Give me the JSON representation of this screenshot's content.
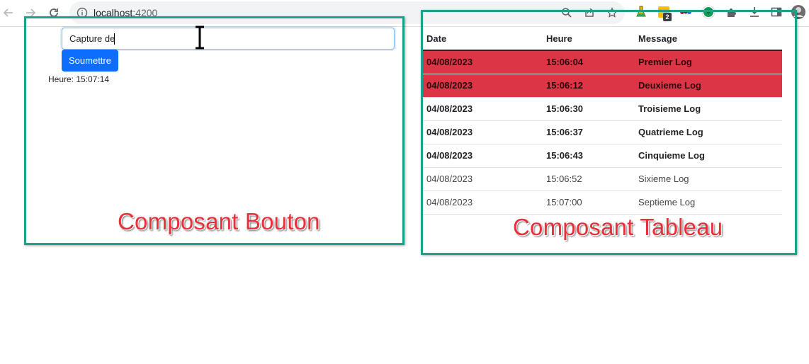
{
  "browser": {
    "url_host": "localhost",
    "url_port": ":4200",
    "extension_badge": "2"
  },
  "button_component": {
    "input_value": "Capture de",
    "submit_label": "Soumettre",
    "time_text": "Heure: 15:07:14",
    "caption": "Composant Bouton"
  },
  "table_component": {
    "headers": [
      "Date",
      "Heure",
      "Message"
    ],
    "rows": [
      {
        "date": "04/08/2023",
        "heure": "15:06:04",
        "message": "Premier Log",
        "style": "danger"
      },
      {
        "date": "04/08/2023",
        "heure": "15:06:12",
        "message": "Deuxieme Log",
        "style": "danger"
      },
      {
        "date": "04/08/2023",
        "heure": "15:06:30",
        "message": "Troisieme Log",
        "style": "bold"
      },
      {
        "date": "04/08/2023",
        "heure": "15:06:37",
        "message": "Quatrieme Log",
        "style": "bold"
      },
      {
        "date": "04/08/2023",
        "heure": "15:06:43",
        "message": "Cinquieme Log",
        "style": "bold"
      },
      {
        "date": "04/08/2023",
        "heure": "15:06:52",
        "message": "Sixieme Log",
        "style": "normal"
      },
      {
        "date": "04/08/2023",
        "heure": "15:07:00",
        "message": "Septieme Log",
        "style": "normal"
      }
    ],
    "caption": "Composant Tableau"
  },
  "colors": {
    "frame": "#1aa38a",
    "danger_row": "#dc3545",
    "primary_button": "#0d6efd",
    "caption": "#e8303b"
  },
  "icons": [
    "back-arrow-icon",
    "forward-arrow-icon",
    "reload-icon",
    "info-icon",
    "zoom-icon",
    "share-icon",
    "bookmark-star-icon",
    "flask-extension-icon",
    "yellow-extension-icon",
    "bird-extension-icon",
    "green-extension-icon",
    "puzzle-extensions-icon",
    "download-icon",
    "side-panel-icon",
    "profile-avatar-icon",
    "text-cursor-icon"
  ]
}
